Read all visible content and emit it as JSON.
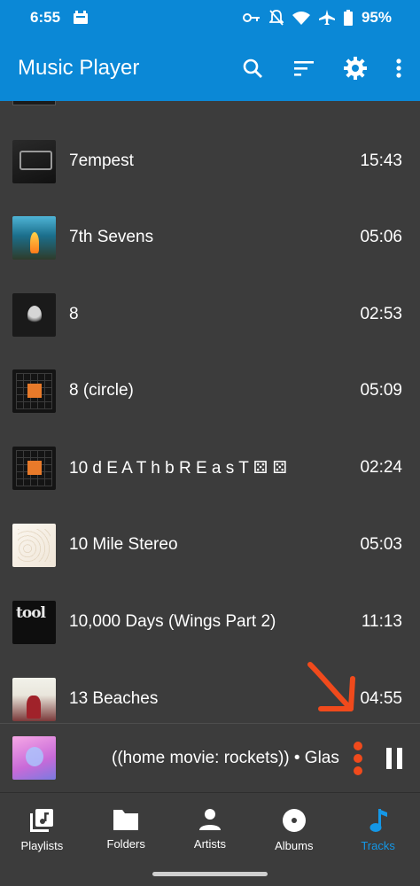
{
  "status_bar": {
    "time": "6:55",
    "battery": "95%",
    "icons": [
      "android-debug-icon",
      "vpn-key-icon",
      "bell-off-icon",
      "wifi-icon",
      "airplane-icon",
      "battery-icon"
    ]
  },
  "app_bar": {
    "title": "Music Player",
    "actions": [
      "search-icon",
      "sort-icon",
      "settings-icon",
      "more-vert-icon"
    ]
  },
  "tracks": [
    {
      "title": "7empest",
      "duration": "15:43",
      "art": "fear-inoculum"
    },
    {
      "title": "7th Sevens",
      "duration": "05:06",
      "art": "cave"
    },
    {
      "title": "8",
      "duration": "02:53",
      "art": "dark-portrait"
    },
    {
      "title": "8 (circle)",
      "duration": "05:09",
      "art": "grid"
    },
    {
      "title": "10 d E A T h b R E a s T ⚄ ⚄",
      "duration": "02:24",
      "art": "grid"
    },
    {
      "title": "10 Mile Stereo",
      "duration": "05:03",
      "art": "light"
    },
    {
      "title": "10,000 Days (Wings Part 2)",
      "duration": "11:13",
      "art": "tool"
    },
    {
      "title": "13 Beaches",
      "duration": "04:55",
      "art": "beach"
    }
  ],
  "now_playing": {
    "text": "((home movie: rockets)) • Glas",
    "state": "playing"
  },
  "bottom_nav": {
    "items": [
      {
        "label": "Playlists",
        "icon": "playlist-icon"
      },
      {
        "label": "Folders",
        "icon": "folder-icon"
      },
      {
        "label": "Artists",
        "icon": "person-icon"
      },
      {
        "label": "Albums",
        "icon": "album-icon"
      },
      {
        "label": "Tracks",
        "icon": "music-note-icon",
        "active": true
      }
    ]
  },
  "colors": {
    "primary": "#0b88d6",
    "background": "#3c3c3c",
    "accent": "#1497e6",
    "annotation": "#f04a1c"
  }
}
